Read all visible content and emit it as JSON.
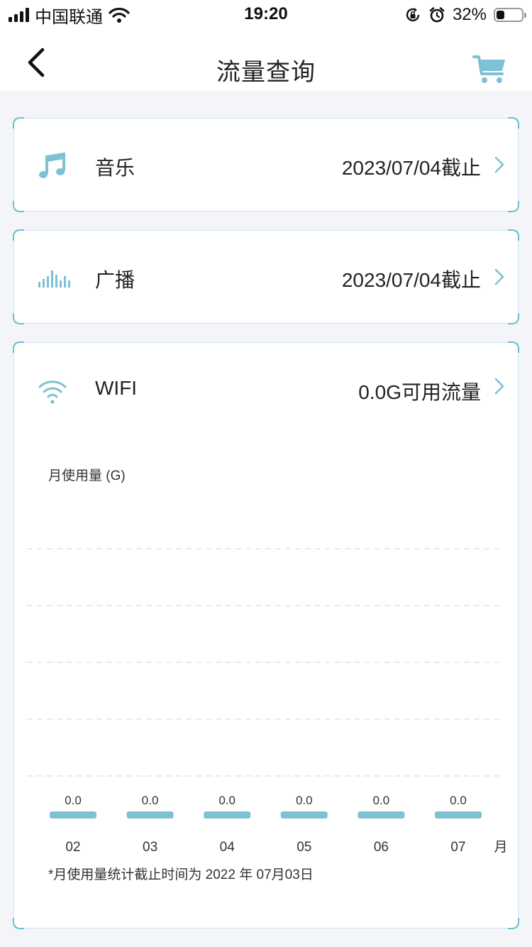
{
  "status_bar": {
    "carrier": "中国联通",
    "time": "19:20",
    "battery": "32%",
    "battery_level": 0.32
  },
  "nav": {
    "title": "流量查询"
  },
  "items": [
    {
      "label": "音乐",
      "value": "2023/07/04截止",
      "icon": "music-note-icon"
    },
    {
      "label": "广播",
      "value": "2023/07/04截止",
      "icon": "broadcast-bars-icon"
    },
    {
      "label": "WIFI",
      "value": "0.0G可用流量",
      "icon": "wifi-icon"
    }
  ],
  "colors": {
    "accent": "#6fbdd1",
    "bar": "#7cc2d4",
    "page_bg": "#f3f5f9"
  },
  "chart_data": {
    "type": "bar",
    "ylabel": "月使用量 (G)",
    "xlabel": "月",
    "categories": [
      "02",
      "03",
      "04",
      "05",
      "06",
      "07"
    ],
    "values": [
      0.0,
      0.0,
      0.0,
      0.0,
      0.0,
      0.0
    ],
    "value_labels": [
      "0.0",
      "0.0",
      "0.0",
      "0.0",
      "0.0",
      "0.0"
    ],
    "grid": true,
    "legend": "none"
  },
  "footnote": "*月使用量统计截止时间为 2022 年 07月03日"
}
